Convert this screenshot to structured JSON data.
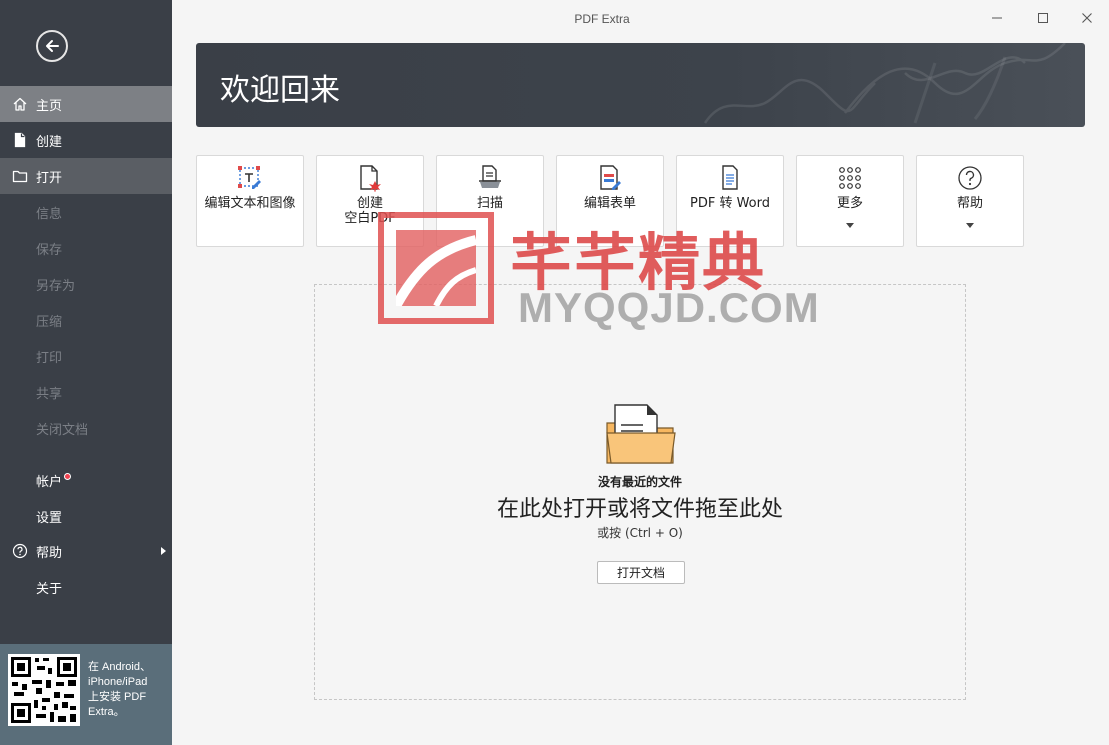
{
  "app": {
    "title": "PDF Extra"
  },
  "sidebar": {
    "items": [
      {
        "label": "主页",
        "icon": "home-icon",
        "state": "active"
      },
      {
        "label": "创建",
        "icon": "file-icon",
        "state": "normal"
      },
      {
        "label": "打开",
        "icon": "folder-icon",
        "state": "selected"
      },
      {
        "label": "信息",
        "state": "disabled"
      },
      {
        "label": "保存",
        "state": "disabled"
      },
      {
        "label": "另存为",
        "state": "disabled"
      },
      {
        "label": "压缩",
        "state": "disabled"
      },
      {
        "label": "打印",
        "state": "disabled"
      },
      {
        "label": "共享",
        "state": "disabled"
      },
      {
        "label": "关闭文档",
        "state": "disabled"
      }
    ],
    "account": "帐户",
    "settings": "设置",
    "help": "帮助",
    "about": "关于",
    "promo": [
      "在 Android、",
      "iPhone/iPad",
      "上安装 PDF",
      "Extra。"
    ]
  },
  "banner": {
    "title": "欢迎回来"
  },
  "tools": [
    {
      "label": "编辑文本和图像",
      "icon": "edit-text-image-icon"
    },
    {
      "label": "创建\n空白PDF",
      "icon": "create-blank-pdf-icon"
    },
    {
      "label": "扫描",
      "icon": "scan-icon"
    },
    {
      "label": "编辑表单",
      "icon": "edit-form-icon"
    },
    {
      "label": "PDF 转 Word",
      "icon": "pdf-to-word-icon"
    },
    {
      "label": "更多",
      "icon": "more-grid-icon"
    },
    {
      "label": "帮助",
      "icon": "help-circle-icon"
    }
  ],
  "dropzone": {
    "no_recent": "没有最近的文件",
    "hint": "在此处打开或将文件拖至此处",
    "shortcut": "或按 (Ctrl + O)",
    "open_button": "打开文档"
  },
  "watermark": {
    "cn": "芊芊精典",
    "en": "MYQQJD.COM"
  },
  "colors": {
    "sidebar": "#3a3f47",
    "active": "#7d8085",
    "banner": "#3a3f47",
    "badge": "#ef4250",
    "folder": "#f7b760"
  }
}
